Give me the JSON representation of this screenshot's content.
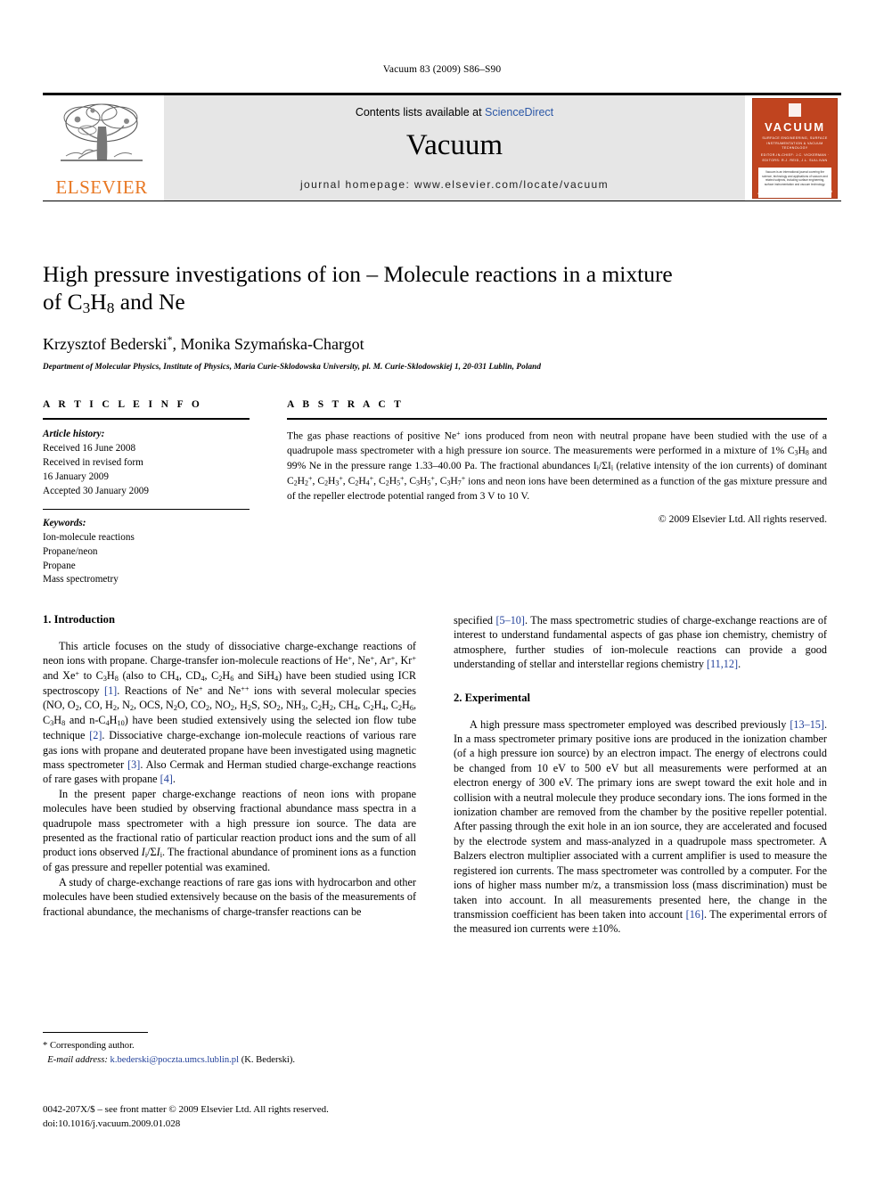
{
  "running_head": "Vacuum 83 (2009) S86–S90",
  "masthead": {
    "contents_prefix": "Contents lists available at",
    "sciencedirect": "ScienceDirect",
    "journal_name": "Vacuum",
    "homepage": "journal homepage: www.elsevier.com/locate/vacuum",
    "publisher_logo_text": "ELSEVIER",
    "publisher_logo_color": "#E87722",
    "link_color": "#2B57A6",
    "cover": {
      "title": "VACUUM",
      "subtitle": "SURFACE ENGINEERING, SURFACE INSTRUMENTATION & VACUUM TECHNOLOGY",
      "editors": "EDITOR-IN-CHIEF: J.C. VICKERMAN  ·  EDITORS: R.J. REID, J.L. SULLIVAN",
      "blurb": "Vacuum is an international journal covering the science, technology and applications of vacuum and related subjects, including surface engineering, surface instrumentation and vacuum technology.",
      "footer": "Available online at ScienceDirect",
      "bottom_line": "www.elsevier.com/locate/vacuum",
      "background_color": "#C0441F"
    }
  },
  "article": {
    "title": "High pressure investigations of ion – Molecule reactions in a mixture of C3H8 and Ne",
    "title_line1_a": "High pressure investigations of ion – Molecule reactions in a mixture",
    "title_line2_a": "of C",
    "title_line2_sub1": "3",
    "title_line2_b": "H",
    "title_line2_sub2": "8",
    "title_line2_c": " and Ne",
    "authors": "Krzysztof Bederski*, Monika Szymańska-Chargot",
    "author_1": "Krzysztof Bederski",
    "author_1_mark": "*",
    "author_2": ", Monika Szymańska-Chargot",
    "affiliation": "Department of Molecular Physics, Institute of Physics, Maria Curie-Sklodowska University, pl. M. Curie-Sklodowskiej 1, 20-031 Lublin, Poland"
  },
  "article_info": {
    "heading": "A R T I C L E   I N F O",
    "history_label": "Article history:",
    "history": [
      "Received 16 June 2008",
      "Received in revised form",
      "16 January 2009",
      "Accepted 30 January 2009"
    ],
    "keywords_label": "Keywords:",
    "keywords": [
      "Ion-molecule reactions",
      "Propane/neon",
      "Propane",
      "Mass spectrometry"
    ]
  },
  "abstract": {
    "heading": "A B S T R A C T",
    "p1_a": "The gas phase reactions of positive Ne",
    "p1_sup1": "+",
    "p1_b": " ions produced from neon with neutral propane have been studied with the use of a quadrupole mass spectrometer with a high pressure ion source. The measurements were performed in a mixture of 1% C",
    "p1_sub1": "3",
    "p1_c": "H",
    "p1_sub2": "8",
    "p1_d": " and 99% Ne in the pressure range 1.33–40.00 Pa. The fractional abundances I",
    "p1_sub3": "i",
    "p1_e": "/ΣI",
    "p1_sub4": "i",
    "p1_f": " (relative intensity of the ion currents) of dominant ",
    "ions": [
      "C2H2+",
      "C2H3+",
      "C2H4+",
      "C2H5+",
      "C3H5+",
      "C3H7+"
    ],
    "p1_g": " ions and neon ions have been determined as a function of the gas mixture pressure and of the repeller electrode potential ranged from 3 V to 10 V.",
    "copyright": "© 2009 Elsevier Ltd. All rights reserved."
  },
  "sections": {
    "intro_heading": "1.  Introduction",
    "experimental_heading": "2.  Experimental"
  },
  "left_column": {
    "p1_a": "This article focuses on the study of dissociative charge-exchange reactions of neon ions with propane. Charge-transfer ion-molecule reactions of He",
    "p1_b": ", Ne",
    "p1_c": ", Ar",
    "p1_d": ", Kr",
    "p1_e": " and Xe",
    "p1_f": " to C",
    "p1_g": "H",
    "p1_h": " (also to CH",
    "p1_i": ", CD",
    "p1_j": ", C",
    "p1_k": "H",
    "p1_l": " and SiH",
    "p1_m": ") have been studied using ICR spectroscopy ",
    "ref1": "[1]",
    "p1_n": ". Reactions of Ne",
    "p1_o": " and Ne",
    "p1_p": " ions with several molecular species (NO, O2, CO, H2, N2, OCS, N2O, CO2, NO2, H2S, SO2, NH3, C2H2, CH4, C2H4, C2H6, C3H8 and n-C4H10) have been studied extensively using the selected ion flow tube technique ",
    "ref2": "[2]",
    "p1_q": ". Dissociative charge-exchange ion-molecule reactions of various rare gas ions with propane and deuterated propane have been investigated using magnetic mass spectrometer ",
    "ref3": "[3]",
    "p1_r": ". Also Cermak and Herman studied charge-exchange reactions of rare gases with propane ",
    "ref4": "[4]",
    "p1_s": ".",
    "p2_a": "In the present paper charge-exchange reactions of neon ions with propane molecules have been studied by observing fractional abundance mass spectra in a quadrupole mass spectrometer with a high pressure ion source. The data are presented as the fractional ratio of particular reaction product ions and the sum of all product ions observed ",
    "p2_italic": "I",
    "p2_sub1": "i",
    "p2_b": "/Σ",
    "p2_italic2": "I",
    "p2_sub2": "i",
    "p2_c": ". The fractional abundance of prominent ions as a function of gas pressure and repeller potential was examined.",
    "p3": "A study of charge-exchange reactions of rare gas ions with hydrocarbon and other molecules have been studied extensively because on the basis of the measurements of fractional abundance, the mechanisms of charge-transfer reactions can be"
  },
  "right_column": {
    "p1_a": "specified ",
    "ref5": "[5–10]",
    "p1_b": ". The mass spectrometric studies of charge-exchange reactions are of interest to understand fundamental aspects of gas phase ion chemistry, chemistry of atmosphere, further studies of ion-molecule reactions can provide a good understanding of stellar and interstellar regions chemistry ",
    "ref11": "[11,12]",
    "p1_c": ".",
    "p2_a": "A high pressure mass spectrometer employed was described previously ",
    "ref13": "[13–15]",
    "p2_b": ". In a mass spectrometer primary positive ions are produced in the ionization chamber (of a high pressure ion source) by an electron impact. The energy of electrons could be changed from 10 eV to 500 eV but all measurements were performed at an electron energy of 300 eV. The primary ions are swept toward the exit hole and in collision with a neutral molecule they produce secondary ions. The ions formed in the ionization chamber are removed from the chamber by the positive repeller potential. After passing through the exit hole in an ion source, they are accelerated and focused by the electrode system and mass-analyzed in a quadrupole mass spectrometer. A Balzers electron multiplier associated with a current amplifier is used to measure the registered ion currents. The mass spectrometer was controlled by a computer. For the ions of higher mass number m/z, a transmission loss (mass discrimination) must be taken into account. In all measurements presented here, the change in the transmission coefficient has been taken into account ",
    "ref16": "[16]",
    "p2_c": ". The experimental errors of the measured ion currents were ±10%."
  },
  "footnotes": {
    "corresponding": "* Corresponding author.",
    "email_label": "E-mail address:",
    "email": "k.bederski@poczta.umcs.lublin.pl",
    "email_owner": "(K. Bederski).",
    "issn_line": "0042-207X/$ – see front matter © 2009 Elsevier Ltd. All rights reserved.",
    "doi_line": "doi:10.1016/j.vacuum.2009.01.028"
  }
}
